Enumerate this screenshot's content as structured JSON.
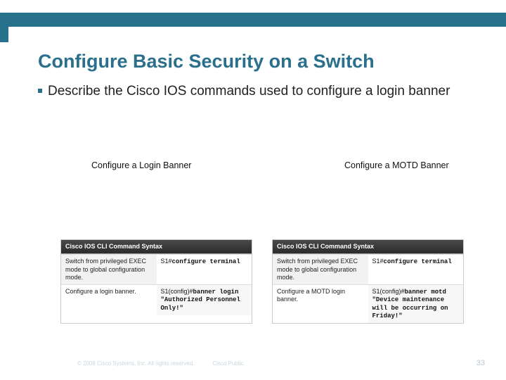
{
  "slide": {
    "title": "Configure Basic Security on a Switch",
    "bullet": "Describe the Cisco IOS commands used to configure a login banner"
  },
  "panels": {
    "left_title": "Configure a Login Banner",
    "right_title": "Configure a MOTD Banner"
  },
  "table_left": {
    "header": "Cisco IOS CLI Command Syntax",
    "rows": [
      {
        "desc": "Switch from privileged EXEC mode to global configuration mode.",
        "prompt": "S1#",
        "cmd": "configure terminal"
      },
      {
        "desc": "Configure a login banner.",
        "prompt": "S1(config)#",
        "cmd": "banner login \"Authorized Personnel Only!\""
      }
    ]
  },
  "table_right": {
    "header": "Cisco IOS CLI Command Syntax",
    "rows": [
      {
        "desc": "Switch from privileged EXEC mode to global configuration mode.",
        "prompt": "S1#",
        "cmd": "configure terminal"
      },
      {
        "desc": "Configure a MOTD login banner.",
        "prompt": "S1(config)#",
        "cmd": "banner motd \"Device maintenance will be occurring on Friday!\""
      }
    ]
  },
  "footer": {
    "copyright": "© 2006 Cisco Systems, Inc. All rights reserved.",
    "pub": "Cisco Public",
    "page": "33"
  }
}
